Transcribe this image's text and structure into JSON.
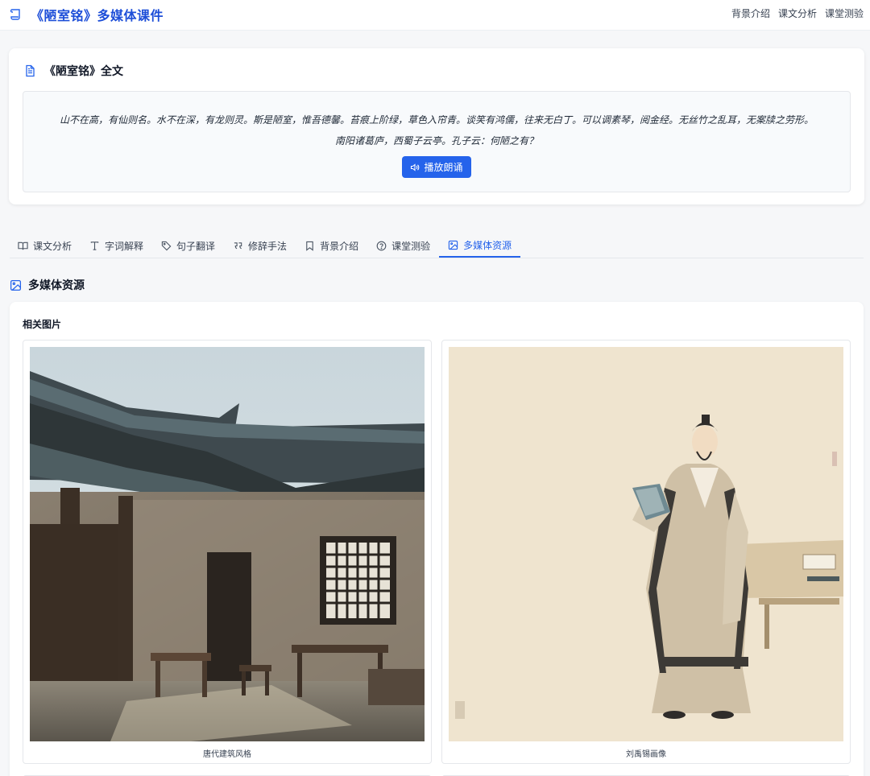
{
  "header": {
    "title": "《陋室铭》多媒体课件",
    "nav": [
      "背景介绍",
      "课文分析",
      "课堂测验"
    ]
  },
  "fulltext": {
    "title": "《陋室铭》全文",
    "poem_line1": "山不在高，有仙则名。水不在深，有龙则灵。斯是陋室，惟吾德馨。苔痕上阶绿，草色入帘青。谈笑有鸿儒，往来无白丁。可以调素琴，阅金经。无丝竹之乱耳，无案牍之劳形。",
    "poem_line2": "南阳诸葛庐，西蜀子云亭。孔子云：何陋之有？",
    "play_label": "播放朗诵"
  },
  "tabs": [
    {
      "label": "课文分析",
      "icon": "book-open-icon"
    },
    {
      "label": "字词解释",
      "icon": "type-icon"
    },
    {
      "label": "句子翻译",
      "icon": "tag-icon"
    },
    {
      "label": "修辞手法",
      "icon": "quote-icon"
    },
    {
      "label": "背景介绍",
      "icon": "bookmark-icon"
    },
    {
      "label": "课堂测验",
      "icon": "help-circle-icon"
    },
    {
      "label": "多媒体资源",
      "icon": "image-icon"
    }
  ],
  "active_tab": "多媒体资源",
  "section": {
    "title": "多媒体资源",
    "images_heading": "相关图片",
    "images": [
      {
        "caption": "唐代建筑风格"
      },
      {
        "caption": "刘禹锡画像"
      }
    ]
  },
  "colors": {
    "accent": "#2563eb",
    "background": "#f6f7f9"
  }
}
